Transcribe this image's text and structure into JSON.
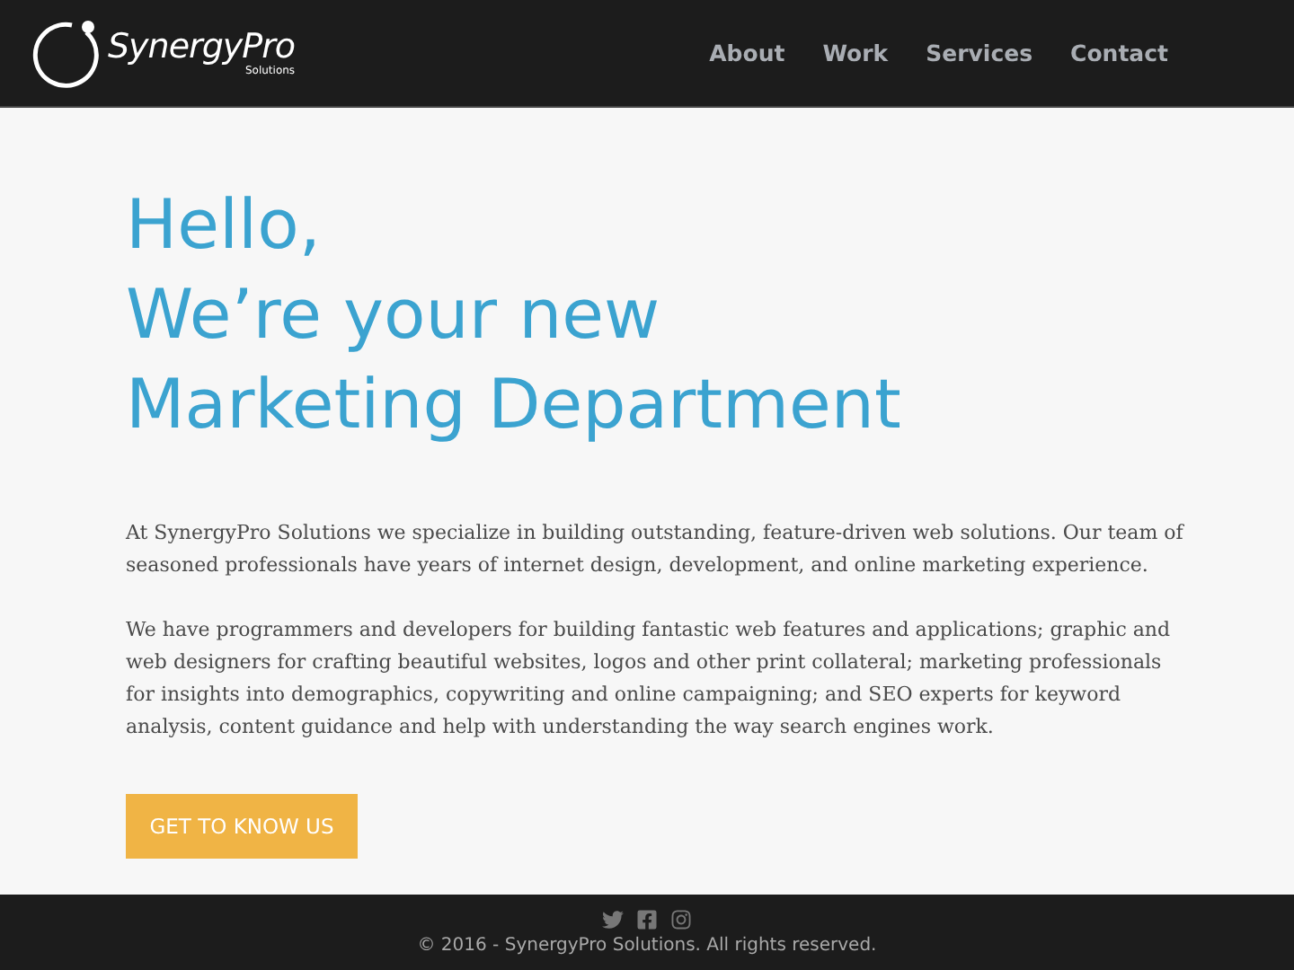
{
  "header": {
    "logo": {
      "name": "SynergyPro",
      "tagline": "Solutions"
    },
    "nav": [
      {
        "label": "About"
      },
      {
        "label": "Work"
      },
      {
        "label": "Services"
      },
      {
        "label": "Contact"
      }
    ]
  },
  "hero": {
    "headline": [
      "Hello,",
      "We’re your new",
      "Marketing Department"
    ],
    "paragraphs": [
      "At SynergyPro Solutions we specialize in building outstanding, feature-driven web solutions. Our team of seasoned professionals have years of internet design, development, and online marketing experience.",
      "We have programmers and developers for building fantastic web features and applications; graphic and web designers for crafting beautiful websites, logos and other print collateral; marketing professionals for insights into demographics, copywriting and online campaigning; and SEO experts for keyword analysis, content guidance and help with understanding the way search engines work."
    ],
    "cta": "GET TO KNOW US"
  },
  "footer": {
    "social": [
      {
        "kind": "twitter"
      },
      {
        "kind": "facebook"
      },
      {
        "kind": "instagram"
      }
    ],
    "copyright": "© 2016 - SynergyPro Solutions. All rights reserved."
  }
}
